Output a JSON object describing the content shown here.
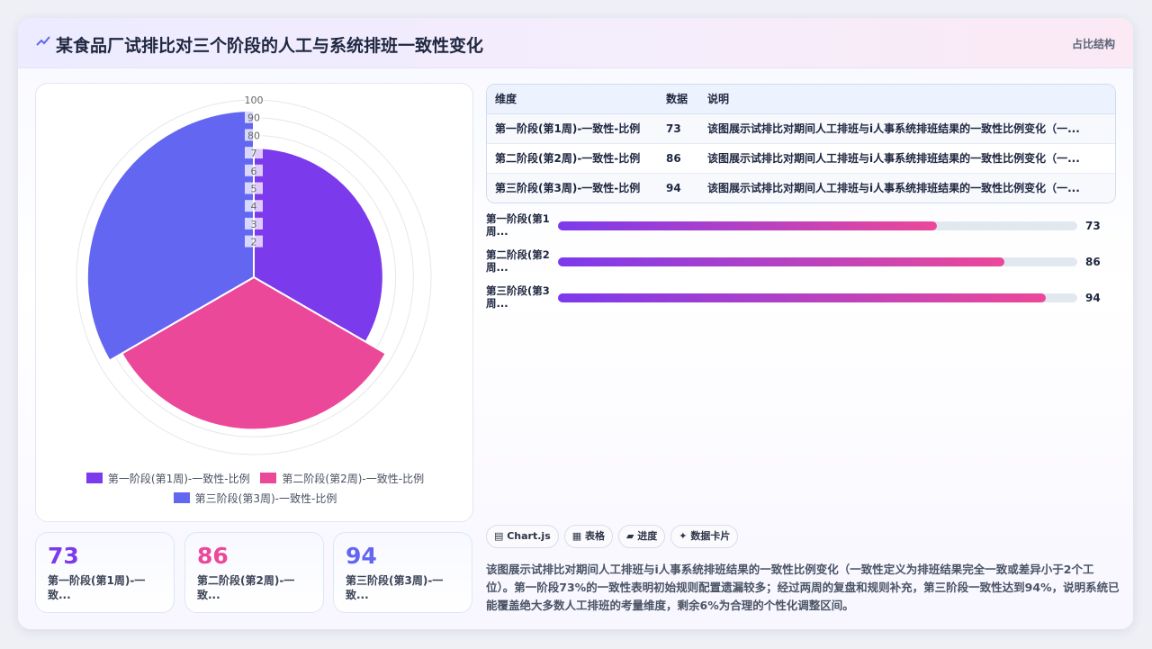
{
  "header": {
    "title": "某食品厂试排比对三个阶段的人工与系统排班一致性变化",
    "tag": "占比结构",
    "icon": "trend-line-icon"
  },
  "chart_data": {
    "type": "polarArea",
    "categories": [
      "第一阶段(第1周)-一致性-比例",
      "第二阶段(第2周)-一致性-比例",
      "第三阶段(第3周)-一致性-比例"
    ],
    "values": [
      73,
      86,
      94
    ],
    "colors": [
      "#7c3aed",
      "#ec4899",
      "#6366f1"
    ],
    "r_ticks": [
      10,
      20,
      30,
      40,
      50,
      60,
      70,
      80,
      90,
      100
    ],
    "r_tick_labels_visible": [
      "100",
      "90",
      "80",
      "7",
      "6",
      "5",
      "4",
      "3",
      "2"
    ],
    "rlim": [
      0,
      100
    ],
    "legend_position": "bottom"
  },
  "table": {
    "headers": [
      "维度",
      "数据",
      "说明"
    ],
    "rows": [
      {
        "name": "第一阶段(第1周)-一致性-比例",
        "value": "73",
        "desc": "该图展示试排比对期间人工排班与i人事系统排班结果的一致性比例变化（一..."
      },
      {
        "name": "第二阶段(第2周)-一致性-比例",
        "value": "86",
        "desc": "该图展示试排比对期间人工排班与i人事系统排班结果的一致性比例变化（一..."
      },
      {
        "name": "第三阶段(第3周)-一致性-比例",
        "value": "94",
        "desc": "该图展示试排比对期间人工排班与i人事系统排班结果的一致性比例变化（一..."
      }
    ]
  },
  "bars": [
    {
      "label": "第一阶段(第1周...",
      "value": 73,
      "value_text": "73"
    },
    {
      "label": "第二阶段(第2周...",
      "value": 86,
      "value_text": "86"
    },
    {
      "label": "第三阶段(第3周...",
      "value": 94,
      "value_text": "94"
    }
  ],
  "bars_max": 100,
  "kpis": [
    {
      "value": "73",
      "label": "第一阶段(第1周)-一致...",
      "color": "#7c3aed"
    },
    {
      "value": "86",
      "label": "第二阶段(第2周)-一致...",
      "color": "#ec4899"
    },
    {
      "value": "94",
      "label": "第三阶段(第3周)-一致...",
      "color": "#6366f1"
    }
  ],
  "chips": [
    {
      "label": "Chart.js",
      "icon": "chart-icon"
    },
    {
      "label": "表格",
      "icon": "table-icon"
    },
    {
      "label": "进度",
      "icon": "progress-icon"
    },
    {
      "label": "数据卡片",
      "icon": "sparkle-icon"
    }
  ],
  "description": "该图展示试排比对期间人工排班与i人事系统排班结果的一致性比例变化（一致性定义为排班结果完全一致或差异小于2个工位）。第一阶段73%的一致性表明初始规则配置遗漏较多；经过两周的复盘和规则补充，第三阶段一致性达到94%，说明系统已能覆盖绝大多数人工排班的考量维度，剩余6%为合理的个性化调整区间。"
}
